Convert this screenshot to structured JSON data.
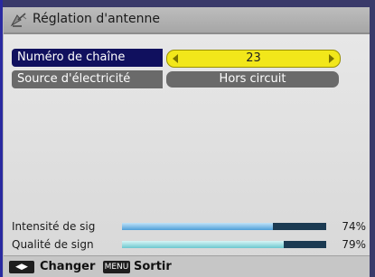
{
  "header": {
    "title": "Réglation d'antenne",
    "icon": "satellite-dish-icon"
  },
  "menu": {
    "items": [
      {
        "label": "Numéro de chaîne",
        "value": "23"
      },
      {
        "label": "Source d'électricité",
        "value": "Hors circuit"
      }
    ]
  },
  "signals": [
    {
      "label": "Intensité de sig",
      "percent": "74%",
      "level": 0.74,
      "color": "#4f9fd8"
    },
    {
      "label": "Qualité de sign",
      "percent": "79%",
      "level": 0.79,
      "color": "#6cc7cf"
    }
  ],
  "help": {
    "change_key": "◀▶",
    "change_label": "Changer",
    "exit_key": "MENU",
    "exit_label": "Sortir"
  },
  "colors": {
    "selected": "#10105e",
    "value_highlight": "#f2e71a",
    "inactive": "#6a6a6a"
  }
}
